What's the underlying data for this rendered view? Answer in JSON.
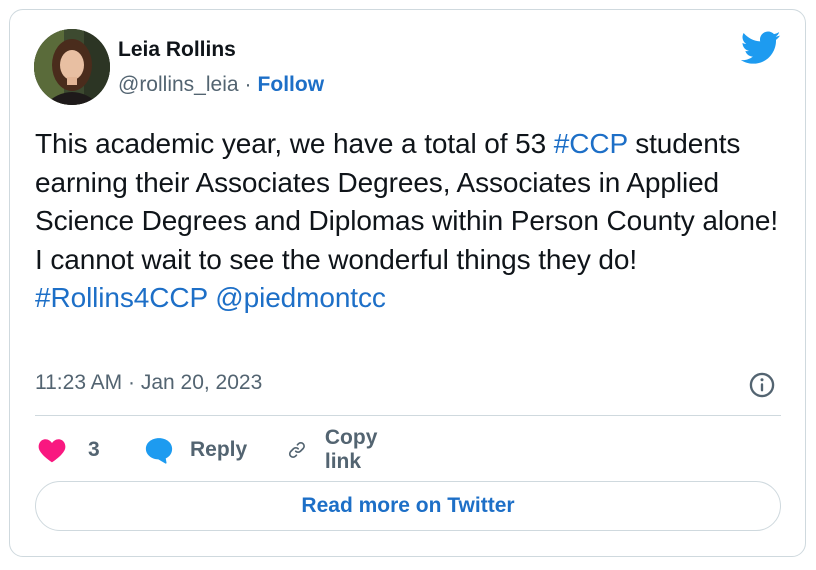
{
  "author": {
    "name": "Leia Rollins",
    "handle": "@rollins_leia",
    "separator": "·",
    "follow_label": "Follow"
  },
  "tweet": {
    "segments": [
      {
        "text": "This academic year, we have a total of 53 ",
        "tag": false
      },
      {
        "text": "#CCP",
        "tag": true
      },
      {
        "text": " students earning their Associates Degrees, Associates in Applied Science Degrees and Diplomas within Person County alone! I cannot wait to see the wonderful things they do! ",
        "tag": false
      },
      {
        "text": "#Rollins4CCP",
        "tag": true
      },
      {
        "text": " ",
        "tag": false
      },
      {
        "text": "@piedmontcc",
        "tag": true
      }
    ],
    "timestamp": "11:23 AM · Jan 20, 2023"
  },
  "actions": {
    "like_count": "3",
    "reply_label": "Reply",
    "copy_link_label": "Copy link"
  },
  "read_more_label": "Read more on Twitter",
  "icons": {
    "twitter": "twitter-bird-icon",
    "info": "info-icon",
    "like": "heart-icon",
    "reply": "speech-bubble-icon",
    "copy": "link-icon"
  },
  "colors": {
    "link": "#1d6fc7",
    "twitter_blue": "#1d9bf0",
    "heart": "#f91880",
    "secondary_text": "#536471",
    "border": "#cfd9de"
  }
}
